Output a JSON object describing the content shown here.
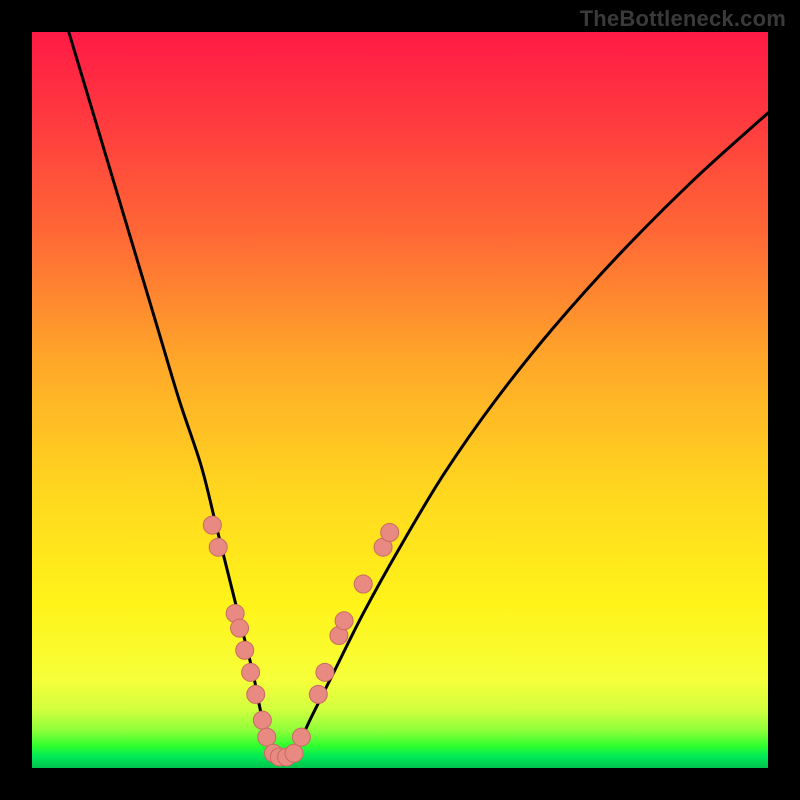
{
  "watermark": "TheBottleneck.com",
  "colors": {
    "frame": "#000000",
    "curve": "#000000",
    "marker_fill": "#e98a82",
    "marker_stroke": "#c96a62",
    "gradient_top": "#ff1a45",
    "gradient_bottom": "#00c24d"
  },
  "chart_data": {
    "type": "line",
    "title": "",
    "xlabel": "",
    "ylabel": "",
    "xlim": [
      0,
      100
    ],
    "ylim": [
      0,
      100
    ],
    "grid": false,
    "legend": false,
    "note": "V-shaped bottleneck curve; y≈0 is ideal (green), y≈100 is worst (red). Pink markers highlight specific sampled configurations near the optimum.",
    "series": [
      {
        "name": "bottleneck-curve",
        "x": [
          5,
          8,
          11,
          14,
          17,
          20,
          23,
          25,
          27,
          28.5,
          30,
          31,
          32,
          33,
          34,
          36,
          38,
          41,
          45,
          50,
          56,
          63,
          71,
          80,
          90,
          100
        ],
        "y": [
          100,
          90,
          80,
          70,
          60,
          50,
          41,
          33,
          25,
          19,
          13,
          8,
          4,
          1.5,
          1.5,
          3,
          7,
          13,
          21,
          30,
          40,
          50,
          60,
          70,
          80,
          89
        ]
      }
    ],
    "markers": [
      {
        "x": 24.5,
        "y": 33
      },
      {
        "x": 25.3,
        "y": 30
      },
      {
        "x": 27.6,
        "y": 21
      },
      {
        "x": 28.2,
        "y": 19
      },
      {
        "x": 28.9,
        "y": 16
      },
      {
        "x": 29.7,
        "y": 13
      },
      {
        "x": 30.4,
        "y": 10
      },
      {
        "x": 31.3,
        "y": 6.5
      },
      {
        "x": 31.9,
        "y": 4.2
      },
      {
        "x": 32.8,
        "y": 2.0
      },
      {
        "x": 33.6,
        "y": 1.5
      },
      {
        "x": 34.6,
        "y": 1.5
      },
      {
        "x": 35.6,
        "y": 2.0
      },
      {
        "x": 36.6,
        "y": 4.2
      },
      {
        "x": 38.9,
        "y": 10
      },
      {
        "x": 39.8,
        "y": 13
      },
      {
        "x": 41.7,
        "y": 18
      },
      {
        "x": 42.4,
        "y": 20
      },
      {
        "x": 45.0,
        "y": 25
      },
      {
        "x": 47.7,
        "y": 30
      },
      {
        "x": 48.6,
        "y": 32
      }
    ]
  }
}
